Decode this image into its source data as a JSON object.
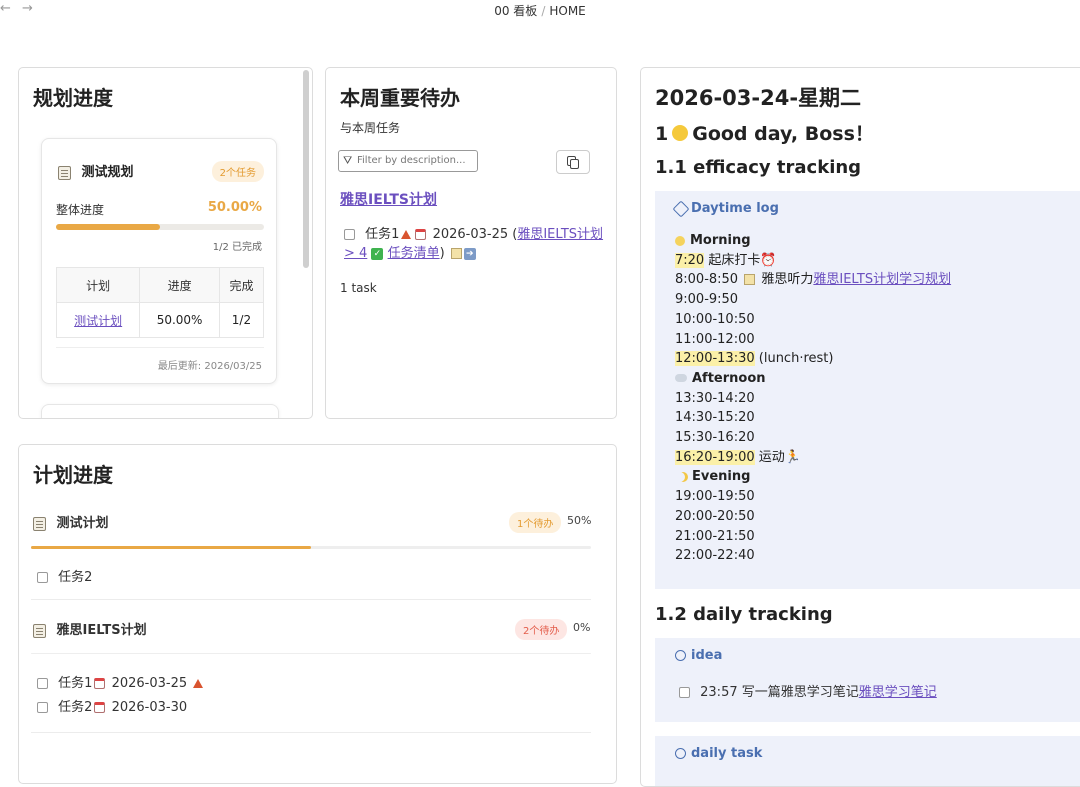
{
  "topbar": {
    "back_icon": "arrow-left-icon",
    "forward_icon": "arrow-right-icon",
    "breadcrumb_1": "00 看板",
    "breadcrumb_sep": "/",
    "breadcrumb_2": "HOME"
  },
  "planning_panel": {
    "title": "规划进度",
    "card": {
      "name": "测试规划",
      "badge": "2个任务",
      "overall_label": "整体进度",
      "percent_text": "50.00%",
      "progress": 0.5,
      "completed_text": "1/2 已完成",
      "table_headers": [
        "计划",
        "进度",
        "完成"
      ],
      "table_row": {
        "plan": "测试计划",
        "progress": "50.00%",
        "done": "1/2"
      },
      "updated": "最后更新: 2026/03/25"
    }
  },
  "weekly_panel": {
    "title": "本周重要待办",
    "subtitle": "与本周任务",
    "filter_placeholder": "Filter by description...",
    "project_link": "雅思IELTS计划",
    "task": {
      "name": "任务1",
      "date": "2026-03-25",
      "link_open": "(",
      "link_text": "雅思IELTS计划 > 4",
      "link_text_2": "任务清单",
      "close": ")"
    },
    "count": "1 task"
  },
  "plan_progress_panel": {
    "title": "计划进度",
    "plans": [
      {
        "name": "测试计划",
        "badge": "1个待办",
        "percent": "50%",
        "progress": 0.5,
        "tasks": [
          {
            "label": "任务2"
          }
        ]
      },
      {
        "name": "雅思IELTS计划",
        "badge": "2个待办",
        "percent": "0%",
        "progress": 0.0,
        "tasks": [
          {
            "label": "任务1",
            "date": "2026-03-25"
          },
          {
            "label": "任务2",
            "date": "2026-03-30"
          }
        ]
      }
    ]
  },
  "journal_panel": {
    "date_title": "2026-03-24-星期二",
    "greeting_num": "1",
    "greeting": "Good day, Boss！",
    "h_efficacy": "1.1 efficacy tracking",
    "daytime_log": "Daytime log",
    "morning": "Morning",
    "afternoon": "Afternoon",
    "evening": "Evening",
    "t_0720": "7:20",
    "t_0720_note": "起床打卡",
    "t_0800": "8:00-8:50",
    "t_0800_note": "雅思听力",
    "t_0800_link": "雅思IELTS计划学习规划",
    "t_0900": "9:00-9:50",
    "t_1000": "10:00-10:50",
    "t_1100": "11:00-12:00",
    "t_1200": "12:00-13:30",
    "t_1200_note": "(lunch·rest)",
    "t_1330": "13:30-14:20",
    "t_1430": "14:30-15:20",
    "t_1530": "15:30-16:20",
    "t_1620": "16:20-19:00",
    "t_1620_note": "运动",
    "t_1900": "19:00-19:50",
    "t_2000": "20:00-20:50",
    "t_2100": "21:00-21:50",
    "t_2200": "22:00-22:40",
    "h_daily": "1.2 daily tracking",
    "idea_label": "idea",
    "idea_item": "23:57 写一篇雅思学习笔记",
    "idea_link": "雅思学习笔记",
    "daily_task_label": "daily task"
  }
}
